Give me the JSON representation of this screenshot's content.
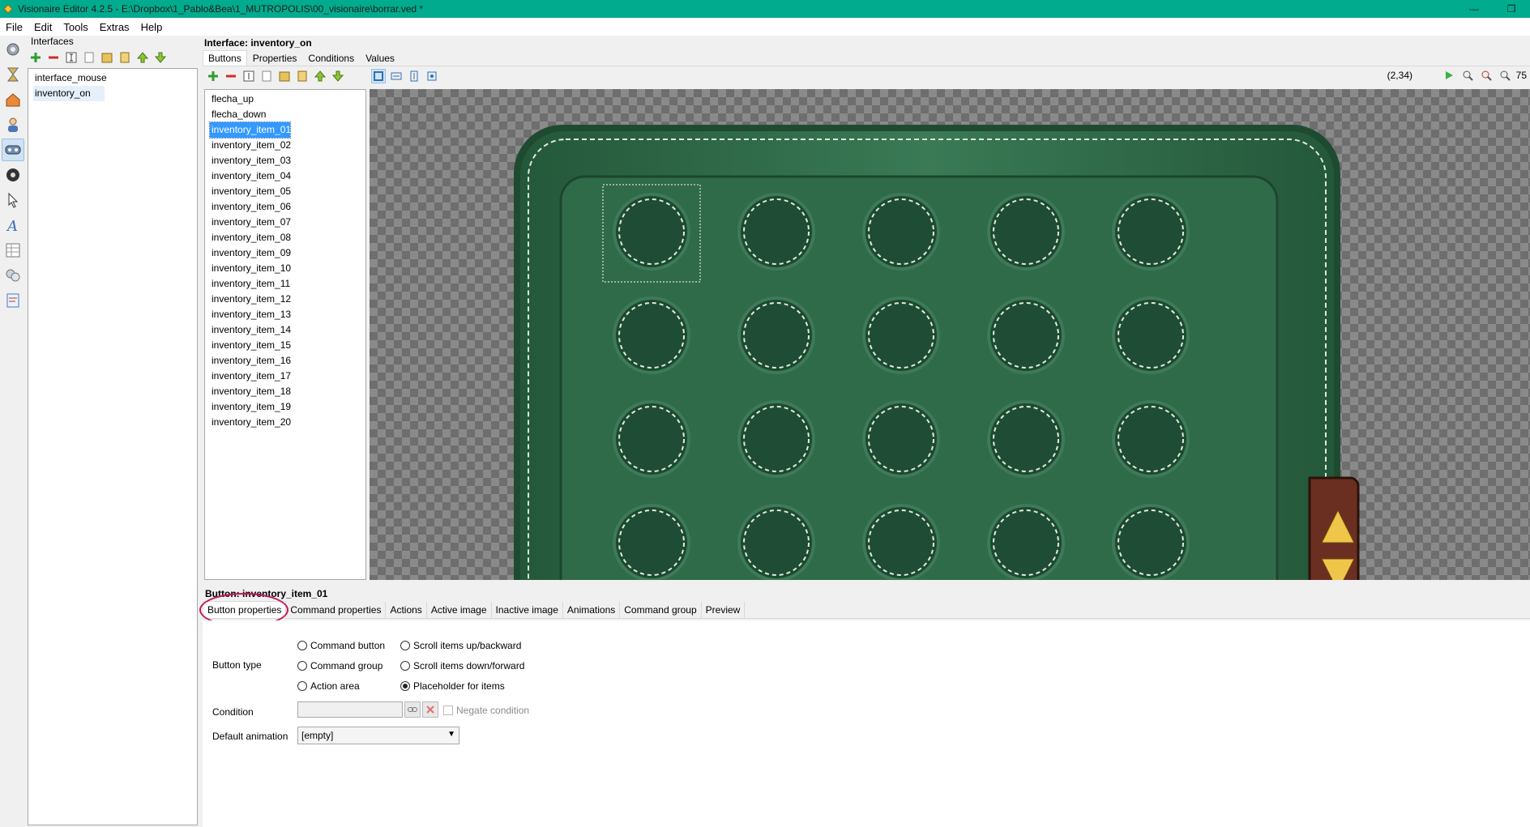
{
  "window": {
    "title": "Visionaire Editor 4.2.5 - E:\\Dropbox\\1_Pablo&Bea\\1_MUTROPOLIS\\00_visionaire\\borrar.ved *",
    "minimize": "—",
    "restore": "❐"
  },
  "menu": [
    "File",
    "Edit",
    "Tools",
    "Extras",
    "Help"
  ],
  "interfaces_panel": {
    "title": "Interfaces",
    "items": [
      "interface_mouse",
      "inventory_on"
    ],
    "selected": "inventory_on"
  },
  "interface": {
    "title": "Interface: inventory_on",
    "tabs": [
      "Buttons",
      "Properties",
      "Conditions",
      "Values"
    ],
    "active_tab": "Buttons",
    "coords": "(2,34)",
    "zoom_partial": "75"
  },
  "buttons": {
    "items": [
      "flecha_up",
      "flecha_down",
      "inventory_item_01",
      "inventory_item_02",
      "inventory_item_03",
      "inventory_item_04",
      "inventory_item_05",
      "inventory_item_06",
      "inventory_item_07",
      "inventory_item_08",
      "inventory_item_09",
      "inventory_item_10",
      "inventory_item_11",
      "inventory_item_12",
      "inventory_item_13",
      "inventory_item_14",
      "inventory_item_15",
      "inventory_item_16",
      "inventory_item_17",
      "inventory_item_18",
      "inventory_item_19",
      "inventory_item_20"
    ],
    "selected": "inventory_item_01"
  },
  "button_panel": {
    "title": "Button: inventory_item_01",
    "tabs": [
      "Button properties",
      "Command properties",
      "Actions",
      "Active image",
      "Inactive image",
      "Animations",
      "Command group",
      "Preview"
    ],
    "active_tab": "Button properties",
    "button_type_label": "Button type",
    "radio_options": {
      "command_button": "Command button",
      "command_group": "Command group",
      "action_area": "Action area",
      "scroll_up": "Scroll items up/backward",
      "scroll_down": "Scroll items down/forward",
      "placeholder": "Placeholder for items"
    },
    "selected_type": "Placeholder for items",
    "condition_label": "Condition",
    "condition_value": "",
    "negate_label": "Negate condition",
    "default_animation_label": "Default animation",
    "default_animation_value": "[empty]"
  },
  "colors": {
    "titlebar": "#00ab8e",
    "selection": "#3399ff",
    "highlight_circle": "#c2185b",
    "inventory_green": "#2e6b48"
  }
}
